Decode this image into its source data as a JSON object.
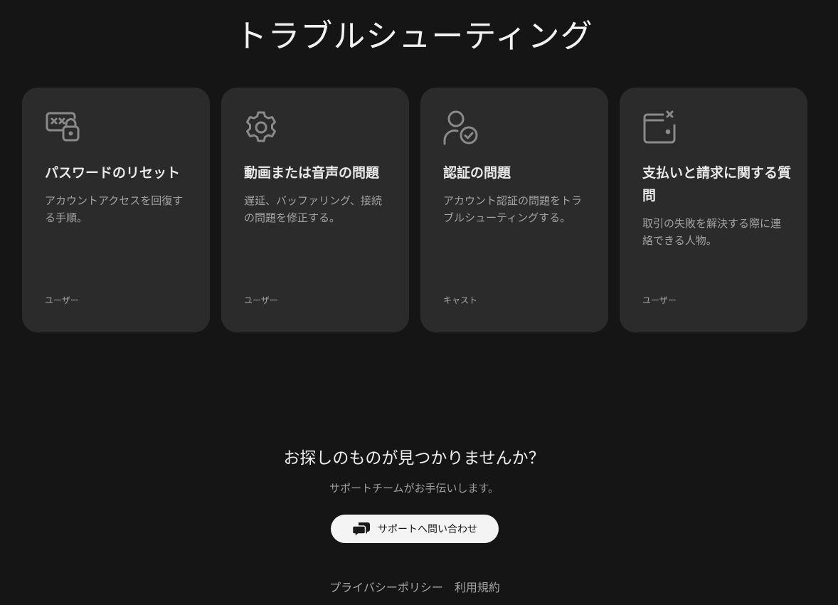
{
  "page_title": "トラブルシューティング",
  "cards": [
    {
      "icon": "password-lock-icon",
      "title": "パスワードのリセット",
      "description": "アカウントアクセスを回復する手順。",
      "role": "ユーザー"
    },
    {
      "icon": "gear-icon",
      "title": "動画または音声の問題",
      "description": "遅延、バッファリング、接続の問題を修正する。",
      "role": "ユーザー"
    },
    {
      "icon": "user-check-icon",
      "title": "認証の問題",
      "description": "アカウント認証の問題をトラブルシューティングする。",
      "role": "キャスト"
    },
    {
      "icon": "wallet-x-icon",
      "title": "支払いと請求に関する質問",
      "description": "取引の失敗を解決する際に連絡できる人物。",
      "role": "ユーザー"
    }
  ],
  "help": {
    "title": "お探しのものが見つかりませんか？",
    "subtitle": "サポートチームがお手伝いします。",
    "button_label": "サポートへ問い合わせ",
    "button_icon": "chat-bubbles-icon"
  },
  "footer": {
    "privacy": "プライバシーポリシー",
    "terms": "利用規約"
  },
  "colors": {
    "background": "#151515",
    "card": "#2b2b2b",
    "icon": "#8a8a8a",
    "button": "#f4f4f4"
  }
}
